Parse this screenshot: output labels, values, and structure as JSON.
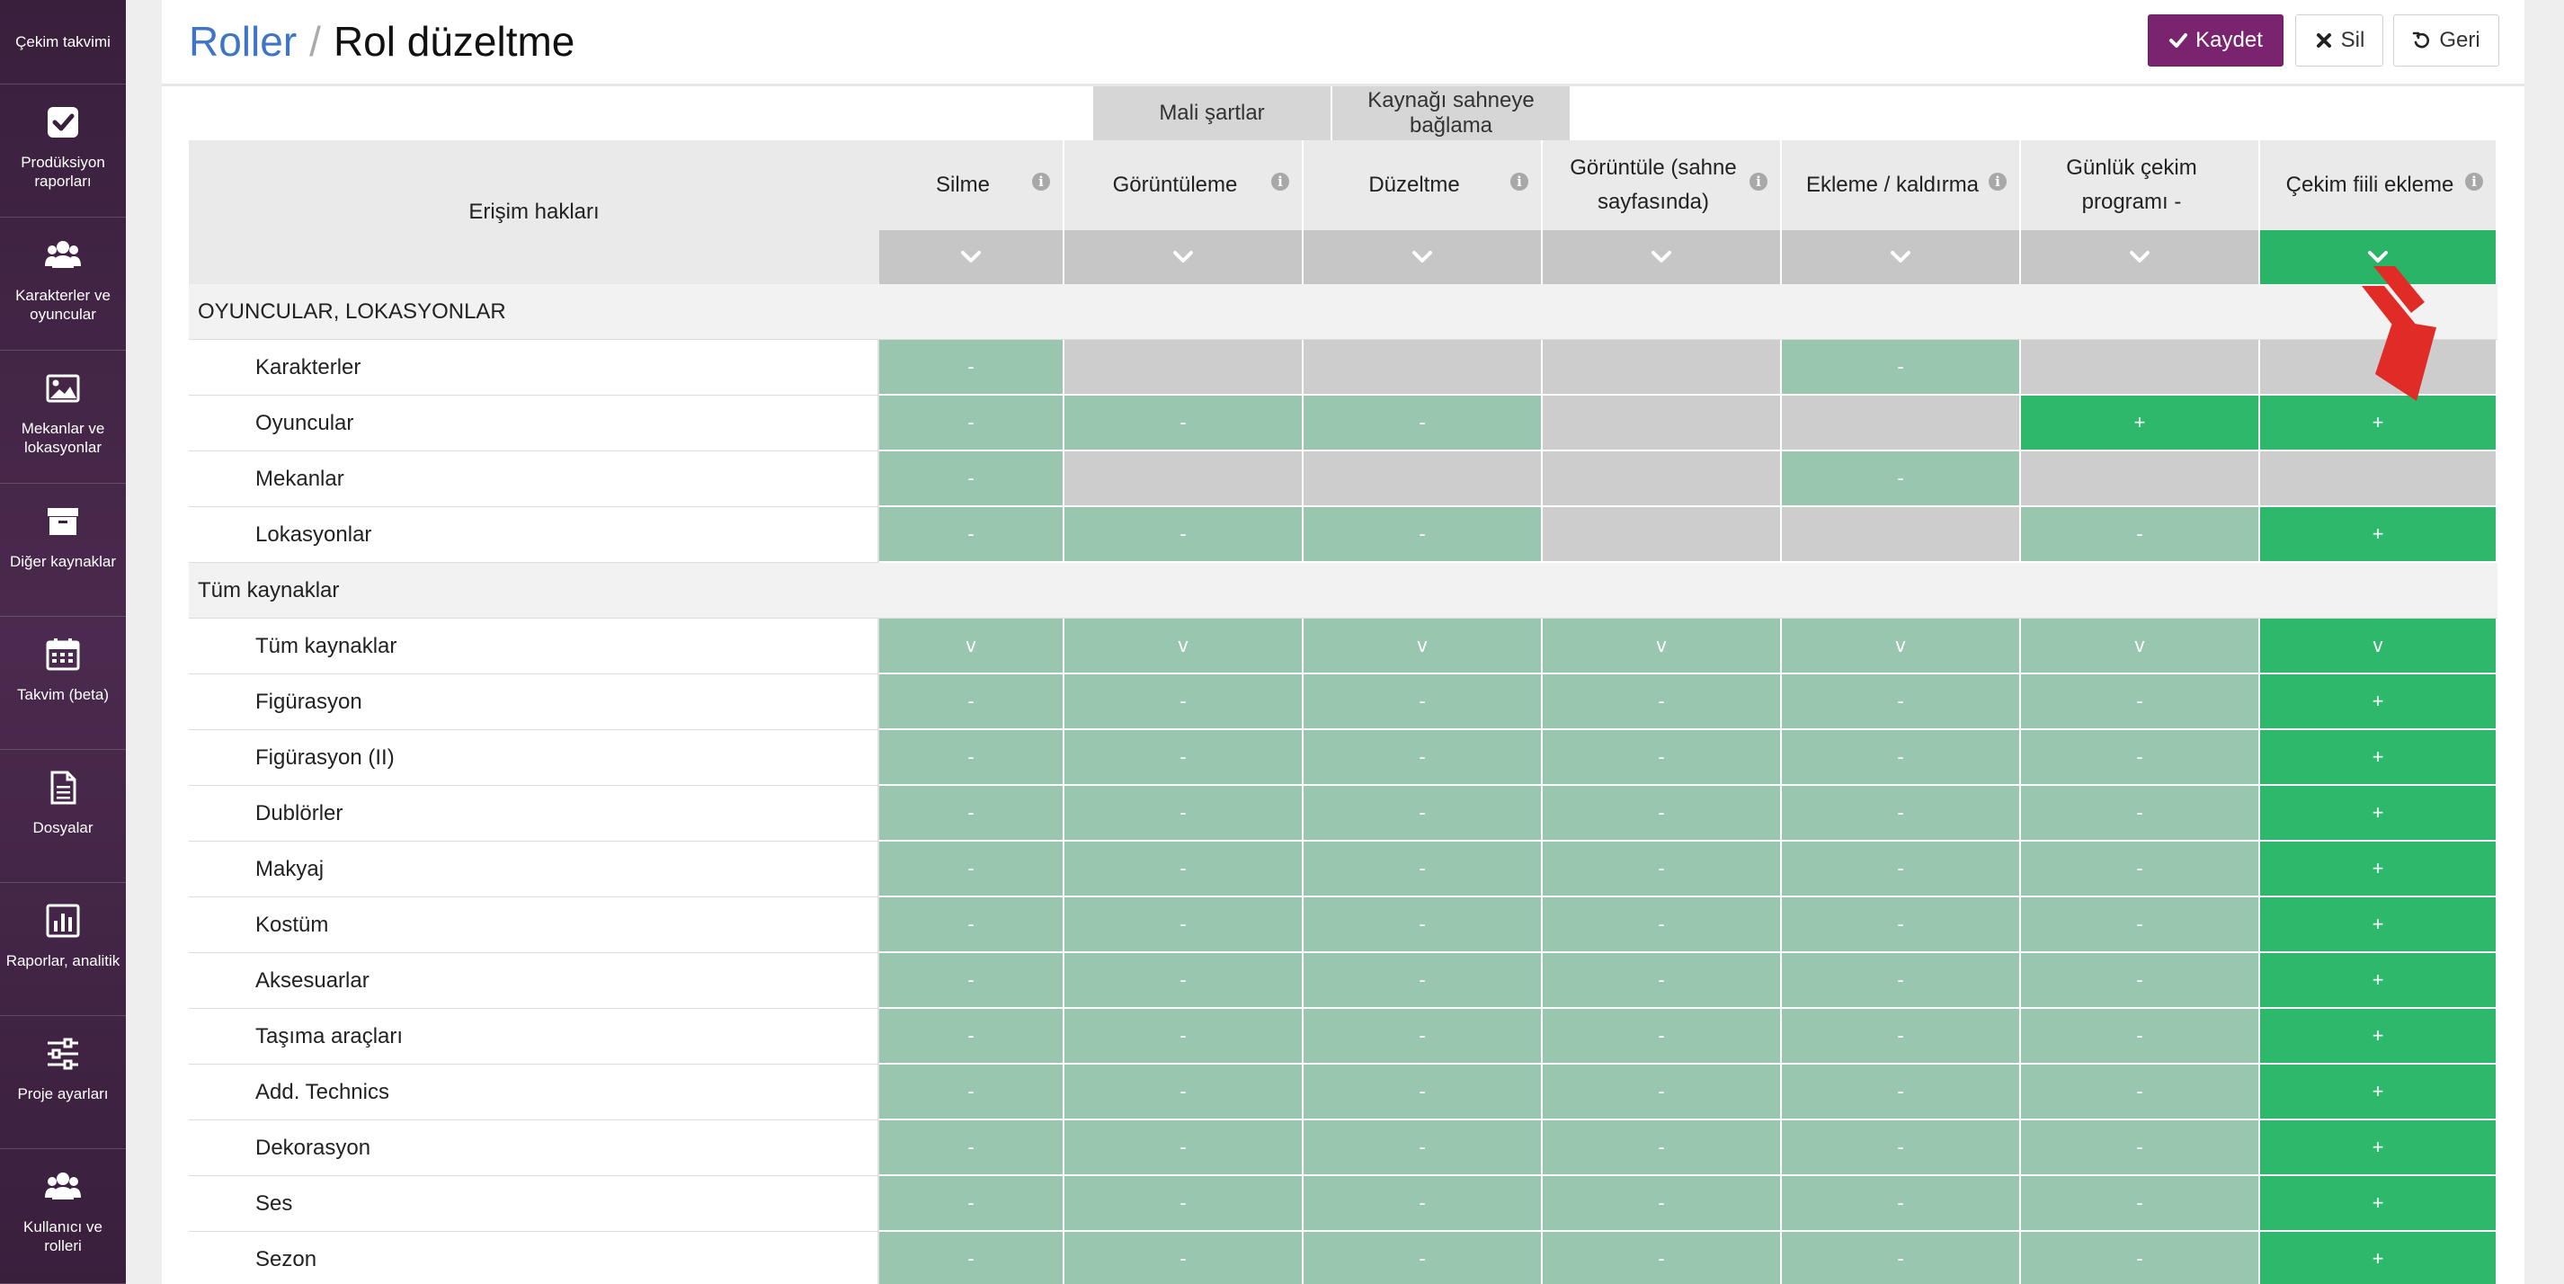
{
  "sidebar": {
    "items": [
      {
        "label": "Çekim takvimi",
        "icon": "calendar-icon"
      },
      {
        "label": "Prodüksiyon raporları",
        "icon": "checkbox-icon"
      },
      {
        "label": "Karakterler ve oyuncular",
        "icon": "users-icon"
      },
      {
        "label": "Mekanlar ve lokasyonlar",
        "icon": "image-icon"
      },
      {
        "label": "Diğer kaynaklar",
        "icon": "archive-icon"
      },
      {
        "label": "Takvim (beta)",
        "icon": "calendar-grid-icon"
      },
      {
        "label": "Dosyalar",
        "icon": "file-icon"
      },
      {
        "label": "Raporlar, analitik",
        "icon": "bar-chart-icon"
      },
      {
        "label": "Proje ayarları",
        "icon": "sliders-icon"
      },
      {
        "label": "Kullanıcı ve rolleri",
        "icon": "users-icon"
      }
    ]
  },
  "header": {
    "breadcrumb": "Roller",
    "separator": "/",
    "title": "Rol düzeltme",
    "save_label": "Kaydet",
    "delete_label": "Sil",
    "back_label": "Geri"
  },
  "table": {
    "access_header": "Erişim hakları",
    "groups": [
      "Mali şartlar",
      "Kaynağı sahneye bağlama"
    ],
    "columns": [
      "Silme",
      "Görüntüleme",
      "Düzeltme",
      "Görüntüle (sahne sayfasında)",
      "Ekleme / kaldırma",
      "Günlük çekim programı -",
      "Çekim fiili ekleme"
    ],
    "sections": [
      {
        "title": "OYUNCULAR, LOKASYONLAR",
        "rows": [
          {
            "label": "Karakterler",
            "cells": [
              "-",
              "",
              "",
              "",
              "-",
              "",
              ""
            ],
            "states": [
              "pale",
              "gray",
              "gray",
              "gray",
              "pale",
              "gray",
              "gray"
            ]
          },
          {
            "label": "Oyuncular",
            "cells": [
              "-",
              "-",
              "-",
              "",
              "",
              "+",
              "+"
            ],
            "states": [
              "pale",
              "pale",
              "pale",
              "gray",
              "gray",
              "strong",
              "strong"
            ]
          },
          {
            "label": "Mekanlar",
            "cells": [
              "-",
              "",
              "",
              "",
              "-",
              "",
              ""
            ],
            "states": [
              "pale",
              "gray",
              "gray",
              "gray",
              "pale",
              "gray",
              "gray"
            ]
          },
          {
            "label": "Lokasyonlar",
            "cells": [
              "-",
              "-",
              "-",
              "",
              "",
              "-",
              "+"
            ],
            "states": [
              "pale",
              "pale",
              "pale",
              "gray",
              "gray",
              "pale",
              "strong"
            ]
          }
        ]
      },
      {
        "title": "Tüm kaynaklar",
        "rows": [
          {
            "label": "Tüm kaynaklar",
            "cells": [
              "v",
              "v",
              "v",
              "v",
              "v",
              "v",
              "v"
            ],
            "states": [
              "pale",
              "pale",
              "pale",
              "pale",
              "pale",
              "pale",
              "strong"
            ]
          },
          {
            "label": "Figürasyon",
            "cells": [
              "-",
              "-",
              "-",
              "-",
              "-",
              "-",
              "+"
            ],
            "states": [
              "pale",
              "pale",
              "pale",
              "pale",
              "pale",
              "pale",
              "strong"
            ]
          },
          {
            "label": "Figürasyon (II)",
            "cells": [
              "-",
              "-",
              "-",
              "-",
              "-",
              "-",
              "+"
            ],
            "states": [
              "pale",
              "pale",
              "pale",
              "pale",
              "pale",
              "pale",
              "strong"
            ]
          },
          {
            "label": "Dublörler",
            "cells": [
              "-",
              "-",
              "-",
              "-",
              "-",
              "-",
              "+"
            ],
            "states": [
              "pale",
              "pale",
              "pale",
              "pale",
              "pale",
              "pale",
              "strong"
            ]
          },
          {
            "label": "Makyaj",
            "cells": [
              "-",
              "-",
              "-",
              "-",
              "-",
              "-",
              "+"
            ],
            "states": [
              "pale",
              "pale",
              "pale",
              "pale",
              "pale",
              "pale",
              "strong"
            ]
          },
          {
            "label": "Kostüm",
            "cells": [
              "-",
              "-",
              "-",
              "-",
              "-",
              "-",
              "+"
            ],
            "states": [
              "pale",
              "pale",
              "pale",
              "pale",
              "pale",
              "pale",
              "strong"
            ]
          },
          {
            "label": "Aksesuarlar",
            "cells": [
              "-",
              "-",
              "-",
              "-",
              "-",
              "-",
              "+"
            ],
            "states": [
              "pale",
              "pale",
              "pale",
              "pale",
              "pale",
              "pale",
              "strong"
            ]
          },
          {
            "label": "Taşıma araçları",
            "cells": [
              "-",
              "-",
              "-",
              "-",
              "-",
              "-",
              "+"
            ],
            "states": [
              "pale",
              "pale",
              "pale",
              "pale",
              "pale",
              "pale",
              "strong"
            ]
          },
          {
            "label": "Add. Technics",
            "cells": [
              "-",
              "-",
              "-",
              "-",
              "-",
              "-",
              "+"
            ],
            "states": [
              "pale",
              "pale",
              "pale",
              "pale",
              "pale",
              "pale",
              "strong"
            ]
          },
          {
            "label": "Dekorasyon",
            "cells": [
              "-",
              "-",
              "-",
              "-",
              "-",
              "-",
              "+"
            ],
            "states": [
              "pale",
              "pale",
              "pale",
              "pale",
              "pale",
              "pale",
              "strong"
            ]
          },
          {
            "label": "Ses",
            "cells": [
              "-",
              "-",
              "-",
              "-",
              "-",
              "-",
              "+"
            ],
            "states": [
              "pale",
              "pale",
              "pale",
              "pale",
              "pale",
              "pale",
              "strong"
            ]
          },
          {
            "label": "Sezon",
            "cells": [
              "-",
              "-",
              "-",
              "-",
              "-",
              "-",
              "+"
            ],
            "states": [
              "pale",
              "pale",
              "pale",
              "pale",
              "pale",
              "pale",
              "strong"
            ]
          }
        ]
      }
    ]
  },
  "colors": {
    "sidebar_bg": "#3a1f3d",
    "brand": "#7a2470",
    "link": "#3e75c4",
    "cell_pale": "#98c6ae",
    "cell_gray": "#cecdce",
    "cell_strong": "#2eb86c",
    "annotation_arrow": "#e02b27"
  }
}
